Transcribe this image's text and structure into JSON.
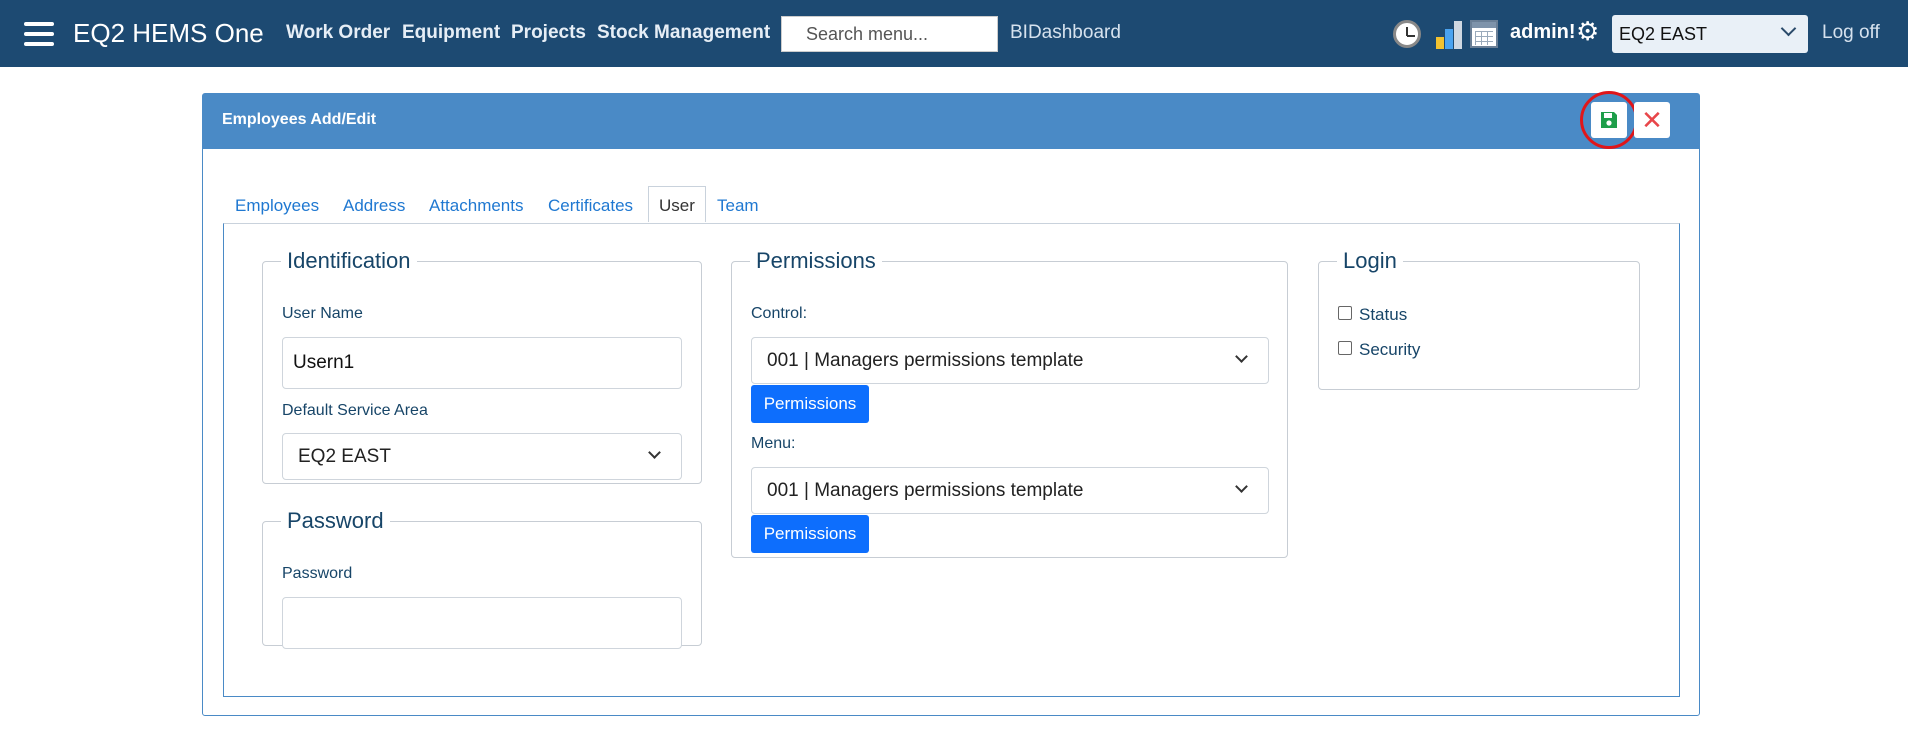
{
  "header": {
    "brand": "EQ2 HEMS One",
    "nav": [
      "Work Order",
      "Equipment",
      "Projects",
      "Stock Management"
    ],
    "search_placeholder": "Search menu...",
    "bi_dashboard": "BIDashboard",
    "user": "admin!",
    "service_area": "EQ2 EAST",
    "log_off": "Log off"
  },
  "panel": {
    "title": "Employees Add/Edit",
    "tabs": [
      "Employees",
      "Address",
      "Attachments",
      "Certificates",
      "User",
      "Team"
    ],
    "active_tab": "User"
  },
  "identification": {
    "legend": "Identification",
    "user_name_label": "User Name",
    "user_name_value": "Usern1",
    "service_area_label": "Default Service Area",
    "service_area_value": "EQ2 EAST"
  },
  "password": {
    "legend": "Password",
    "label": "Password",
    "value": ""
  },
  "permissions": {
    "legend": "Permissions",
    "control_label": "Control:",
    "control_value": "001 | Managers permissions template",
    "menu_label": "Menu:",
    "menu_value": "001 | Managers permissions template",
    "button_label": "Permissions"
  },
  "login": {
    "legend": "Login",
    "options": [
      {
        "label": "Status",
        "checked": false
      },
      {
        "label": "Security",
        "checked": false
      }
    ]
  },
  "colors": {
    "nav_bg": "#1d4a72",
    "panel_header": "#4a8ac6",
    "primary_button": "#0d6efd",
    "save_icon": "#1e9e4a",
    "close_icon": "#e8464a",
    "highlight_ring": "#e0161a"
  }
}
